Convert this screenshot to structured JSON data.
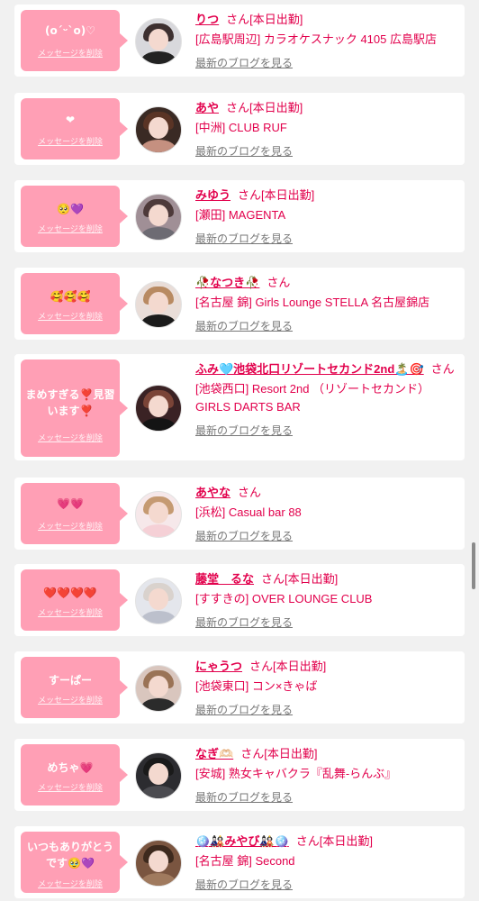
{
  "ui": {
    "delete_label": "メッセージを削除",
    "blog_label": "最新のブログを見る",
    "san": "さん"
  },
  "messages": [
    {
      "message": "(o´ᵕ`o)♡",
      "name": "りつ",
      "status": "[本日出勤]",
      "shop": "[広島駅周辺] カラオケスナック 4105 広島駅店",
      "shop2": ""
    },
    {
      "message": "❤",
      "name": "あや",
      "status": "[本日出勤]",
      "shop": "[中洲] CLUB RUF",
      "shop2": ""
    },
    {
      "message": "🥺💜",
      "name": "みゆう",
      "status": "[本日出勤]",
      "shop": "[瀬田] MAGENTA",
      "shop2": ""
    },
    {
      "message": "🥰🥰🥰",
      "name": "🥀なつき🥀",
      "status": "",
      "shop": "[名古屋 錦] Girls Lounge STELLA 名古屋錦店",
      "shop2": ""
    },
    {
      "message": "まめすぎる❣️見習います❣️",
      "name": "ふみ🩵池袋北口リゾートセカンド2nd🏝️🎯",
      "status": "",
      "shop": "[池袋西口] Resort 2nd （リゾートセカンド）",
      "shop2": "GIRLS DARTS BAR"
    },
    {
      "message": "💗💗",
      "name": "あやな",
      "status": "",
      "shop": "[浜松] Casual bar 88",
      "shop2": ""
    },
    {
      "message": "❤️❤️❤️❤️",
      "name": "藤堂　るな",
      "status": "[本日出勤]",
      "shop": "[すすきの] OVER LOUNGE CLUB",
      "shop2": ""
    },
    {
      "message": "すーぱー",
      "name": "にゃうつ",
      "status": "[本日出勤]",
      "shop": "[池袋東口] コン×きゃば",
      "shop2": ""
    },
    {
      "message": "めちゃ💗",
      "name": "なぎ🫶🏻",
      "status": "[本日出勤]",
      "shop": "[安城] 熟女キャバクラ『乱舞-らんぶ』",
      "shop2": ""
    },
    {
      "message": "いつもありがとうです🥹💜",
      "name": "🪩🎎みやび🎎🪩",
      "status": "[本日出勤]",
      "shop": "[名古屋 錦] Second",
      "shop2": ""
    }
  ],
  "colors": {
    "bubble": "#ff9fb5",
    "accent": "#e2004c",
    "link_gray": "#777777"
  }
}
